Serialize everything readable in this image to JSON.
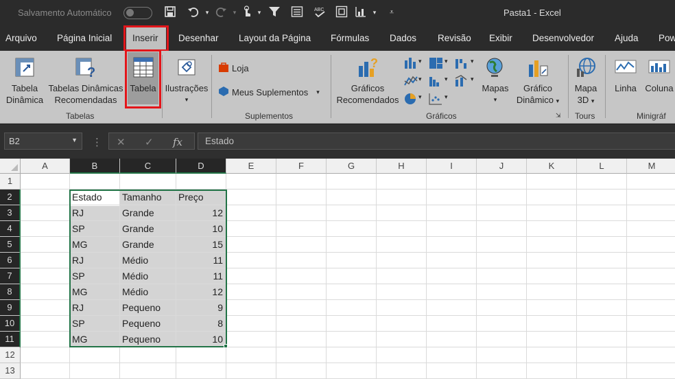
{
  "titlebar": {
    "autosave_label": "Salvamento Automático",
    "title": "Pasta1  -  Excel"
  },
  "tabs": [
    "Arquivo",
    "Página Inicial",
    "Inserir",
    "Desenhar",
    "Layout da Página",
    "Fórmulas",
    "Dados",
    "Revisão",
    "Exibir",
    "Desenvolvedor",
    "Ajuda",
    "Pow"
  ],
  "active_tab": "Inserir",
  "ribbon": {
    "tabela_dinamica": [
      "Tabela",
      "Dinâmica"
    ],
    "tabelas_dinamicas_recomendadas": [
      "Tabelas Dinâmicas",
      "Recomendadas"
    ],
    "tabela": "Tabela",
    "ilustracoes": "Ilustrações",
    "loja": "Loja",
    "meus_suplementos": "Meus Suplementos",
    "graficos_recomendados": [
      "Gráficos",
      "Recomendados"
    ],
    "mapas": "Mapas",
    "grafico_dinamico": [
      "Gráfico",
      "Dinâmico"
    ],
    "mapa3d": [
      "Mapa",
      "3D"
    ],
    "linha": "Linha",
    "coluna": "Coluna",
    "groups": {
      "tabelas": "Tabelas",
      "suplementos": "Suplementos",
      "graficos": "Gráficos",
      "tours": "Tours",
      "minigraficos": "Minigráf"
    }
  },
  "formula_bar": {
    "name_box": "B2",
    "fx": "fx",
    "content": "Estado"
  },
  "columns": [
    "A",
    "B",
    "C",
    "D",
    "E",
    "F",
    "G",
    "H",
    "I",
    "J",
    "K",
    "L",
    "M"
  ],
  "rows": [
    "1",
    "2",
    "3",
    "4",
    "5",
    "6",
    "7",
    "8",
    "9",
    "10",
    "11",
    "12",
    "13"
  ],
  "table": {
    "headers": [
      "Estado",
      "Tamanho",
      "Preço"
    ],
    "rows": [
      [
        "RJ",
        "Grande",
        "12"
      ],
      [
        "SP",
        "Grande",
        "10"
      ],
      [
        "MG",
        "Grande",
        "15"
      ],
      [
        "RJ",
        "Médio",
        "11"
      ],
      [
        "SP",
        "Médio",
        "11"
      ],
      [
        "MG",
        "Médio",
        "12"
      ],
      [
        "RJ",
        "Pequeno",
        "9"
      ],
      [
        "SP",
        "Pequeno",
        "8"
      ],
      [
        "MG",
        "Pequeno",
        "10"
      ]
    ]
  },
  "colors": {
    "highlight_red": "#e3151a",
    "selection_green": "#217346"
  }
}
